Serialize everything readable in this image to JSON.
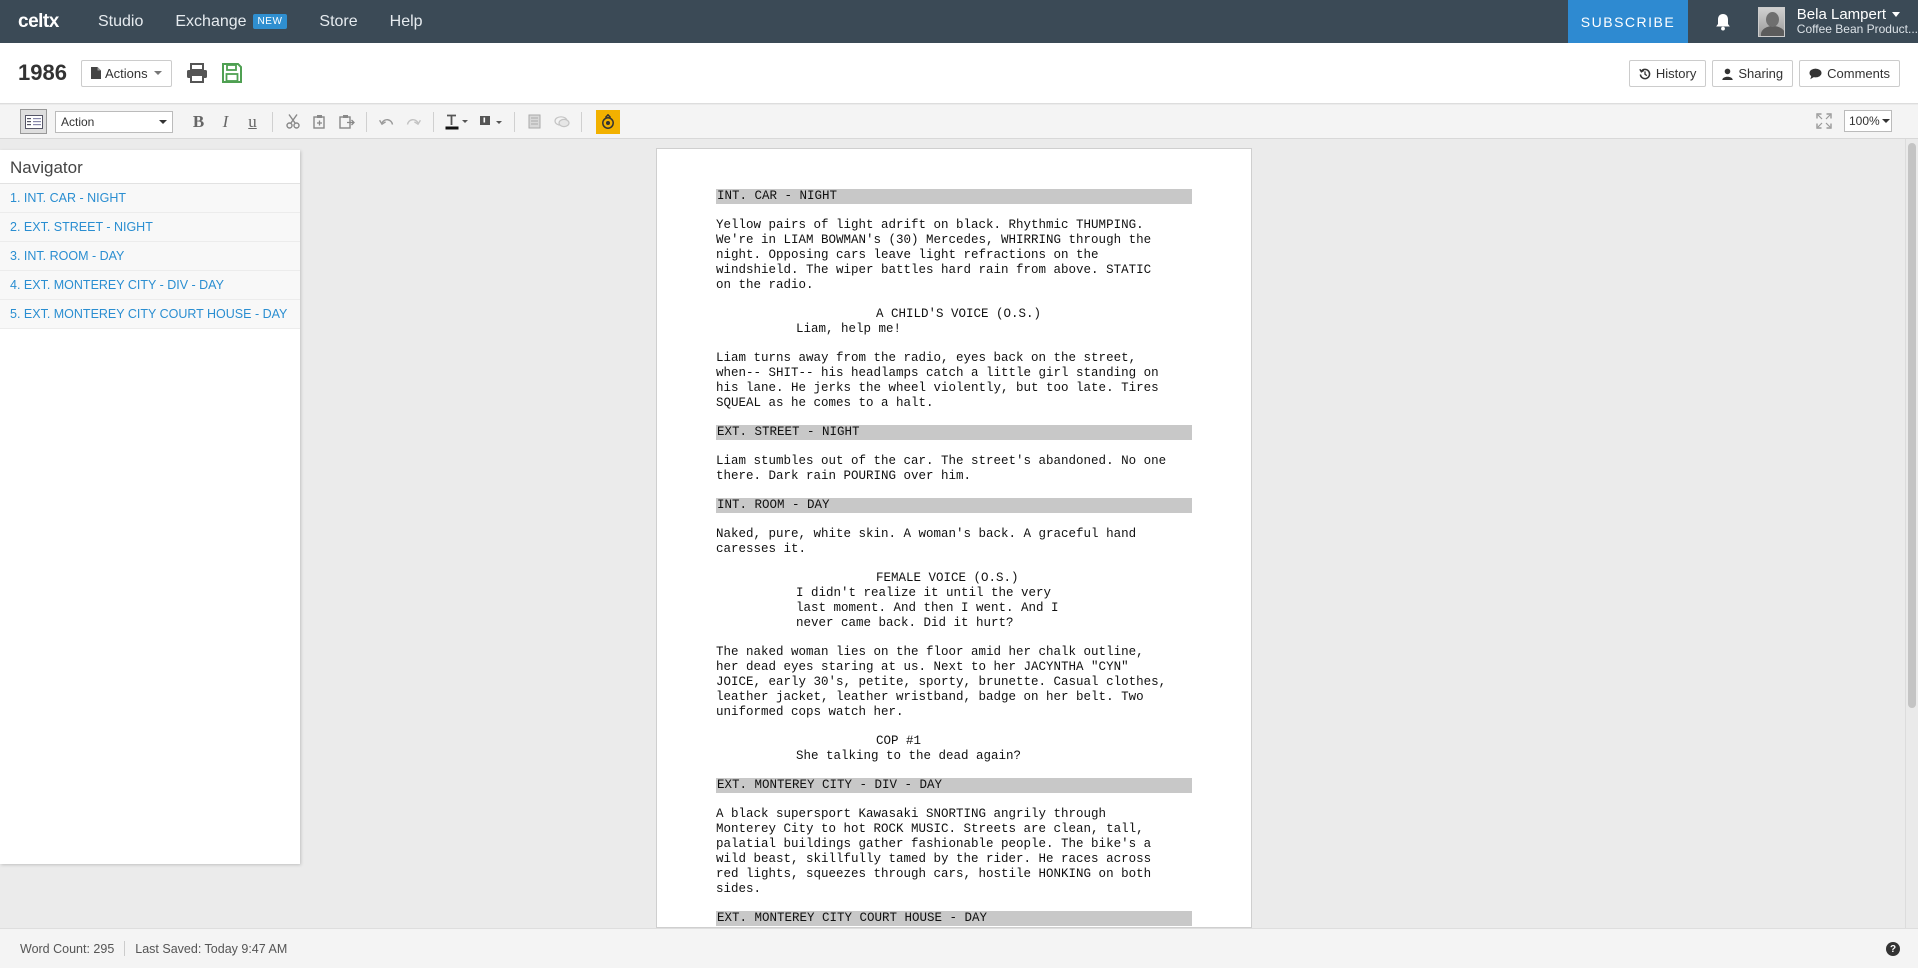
{
  "app": {
    "logo": "celtx",
    "nav": [
      {
        "label": "Studio"
      },
      {
        "label": "Exchange",
        "badge": "NEW"
      },
      {
        "label": "Store"
      },
      {
        "label": "Help"
      }
    ],
    "subscribe_label": "SUBSCRIBE",
    "user": {
      "name": "Bela Lampert",
      "org": "Coffee Bean Product..."
    }
  },
  "document": {
    "title": "1986",
    "actions_label": "Actions",
    "history_label": "History",
    "sharing_label": "Sharing",
    "comments_label": "Comments"
  },
  "toolbar": {
    "element_type": "Action",
    "bold": "B",
    "italic": "I",
    "underline": "u",
    "zoom": "100%"
  },
  "navigator": {
    "title": "Navigator",
    "scenes": [
      "1. INT. CAR - NIGHT",
      "2. EXT. STREET - NIGHT",
      "3. INT. ROOM - DAY",
      "4. EXT. MONTEREY CITY - DIV - DAY",
      "5. EXT. MONTEREY CITY COURT HOUSE - DAY"
    ]
  },
  "script": {
    "s1_heading": "INT. CAR - NIGHT",
    "s1_action1": "Yellow pairs of light adrift on black. Rhythmic THUMPING.\nWe're in LIAM BOWMAN's (30) Mercedes, WHIRRING through the\nnight. Opposing cars leave light refractions on the\nwindshield. The wiper battles hard rain from above. STATIC\non the radio.",
    "s1_char1": "A CHILD'S VOICE (O.S.)",
    "s1_dial1": "Liam, help me!",
    "s1_action2": "Liam turns away from the radio, eyes back on the street,\nwhen-- SHIT-- his headlamps catch a little girl standing on\nhis lane. He jerks the wheel violently, but too late. Tires\nSQUEAL as he comes to a halt.",
    "s2_heading": "EXT. STREET - NIGHT",
    "s2_action1": "Liam stumbles out of the car. The street's abandoned. No one\nthere. Dark rain POURING over him.",
    "s3_heading": "INT. ROOM - DAY",
    "s3_action1": "Naked, pure, white skin. A woman's back. A graceful hand\ncaresses it.",
    "s3_char1": "FEMALE VOICE (O.S.)",
    "s3_dial1": "I didn't realize it until the very\nlast moment. And then I went. And I\nnever came back. Did it hurt?",
    "s3_action2": "The naked woman lies on the floor amid her chalk outline,\nher dead eyes staring at us. Next to her JACYNTHA \"CYN\"\nJOICE, early 30's, petite, sporty, brunette. Casual clothes,\nleather jacket, leather wristband, badge on her belt. Two\nuniformed cops watch her.",
    "s3_char2": "COP #1",
    "s3_dial2": "She talking to the dead again?",
    "s4_heading": "EXT. MONTEREY CITY - DIV - DAY",
    "s4_action1": "A black supersport Kawasaki SNORTING angrily through\nMonterey City to hot ROCK MUSIC. Streets are clean, tall,\npalatial buildings gather fashionable people. The bike's a\nwild beast, skillfully tamed by the rider. He races across\nred lights, squeezes through cars, hostile HONKING on both\nsides.",
    "s5_heading": "EXT. MONTEREY CITY COURT HOUSE - DAY"
  },
  "status": {
    "word_count": "Word Count: 295",
    "last_saved": "Last Saved: Today 9:47 AM",
    "help": "?"
  },
  "colors": {
    "topbar": "#3b4a56",
    "accent": "#2e8ad1",
    "link": "#2a8ed1",
    "scene_heading_bg": "#c8c8c8",
    "highlight": "#f2b100"
  }
}
